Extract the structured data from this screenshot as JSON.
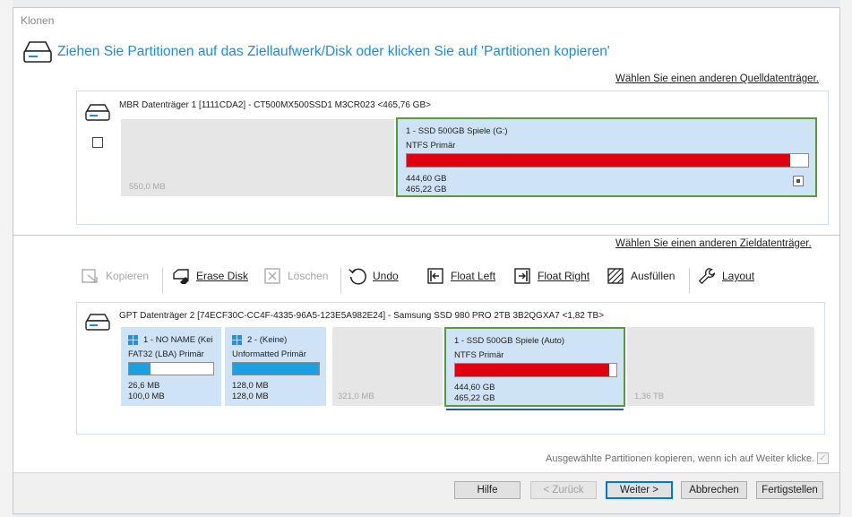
{
  "window": {
    "title": "Klonen"
  },
  "heading": "Ziehen Sie Partitionen auf das Ziellaufwerk/Disk oder klicken Sie auf 'Partitionen kopieren'",
  "source": {
    "link": "Wählen Sie einen anderen Quelldatenträger.",
    "disk_label": "MBR Datenträger 1 [1111CDA2] - CT500MX500SSD1 M3CR023  <465,76 GB>",
    "partitions": [
      {
        "size": "550,0 MB"
      },
      {
        "name": "1 - SSD 500GB Spiele (G:)",
        "fs": "NTFS Primär",
        "used": "444,60 GB",
        "total": "465,22 GB",
        "fill_fraction": 0.955
      }
    ]
  },
  "dest": {
    "link": "Wählen Sie einen anderen Zieldatenträger.",
    "disk_label": "GPT Datenträger 2 [74ECF30C-CC4F-4335-96A5-123E5A982E24] - Samsung SSD 980 PRO 2TB 3B2QGXA7  <1,82 TB>",
    "partitions": [
      {
        "name": "1 - NO NAME (Kei",
        "fs": "FAT32 (LBA) Primär",
        "used": "26,6 MB",
        "total": "100,0 MB",
        "fill_fraction": 0.25
      },
      {
        "name": "2 - (Keine)",
        "fs": "Unformatted Primär",
        "used": "128,0 MB",
        "total": "128,0 MB",
        "fill_fraction": 1.0
      },
      {
        "size": "321,0 MB"
      },
      {
        "name": "1 - SSD 500GB Spiele (Auto)",
        "fs": "NTFS Primär",
        "used": "444,60 GB",
        "total": "465,22 GB",
        "fill_fraction": 0.955
      },
      {
        "size": "1,36 TB"
      }
    ]
  },
  "toolbar": {
    "copy": "Kopieren",
    "erase": "Erase Disk",
    "delete": "Löschen",
    "undo": "Undo",
    "float_left": "Float Left",
    "float_right": "Float Right",
    "fill": "Ausfüllen",
    "layout": "Layout"
  },
  "footnote": "Ausgewählte Partitionen kopieren, wenn ich auf Weiter klicke.",
  "buttons": {
    "help": "Hilfe",
    "back": "< Zurück",
    "next": "Weiter >",
    "cancel": "Abbrechen",
    "finish": "Fertigstellen"
  },
  "colors": {
    "accent": "#1f8dd6",
    "used_fill": "#e0000f",
    "fat_fill": "#1ba1e2",
    "selected_border": "#5b9a3b"
  }
}
